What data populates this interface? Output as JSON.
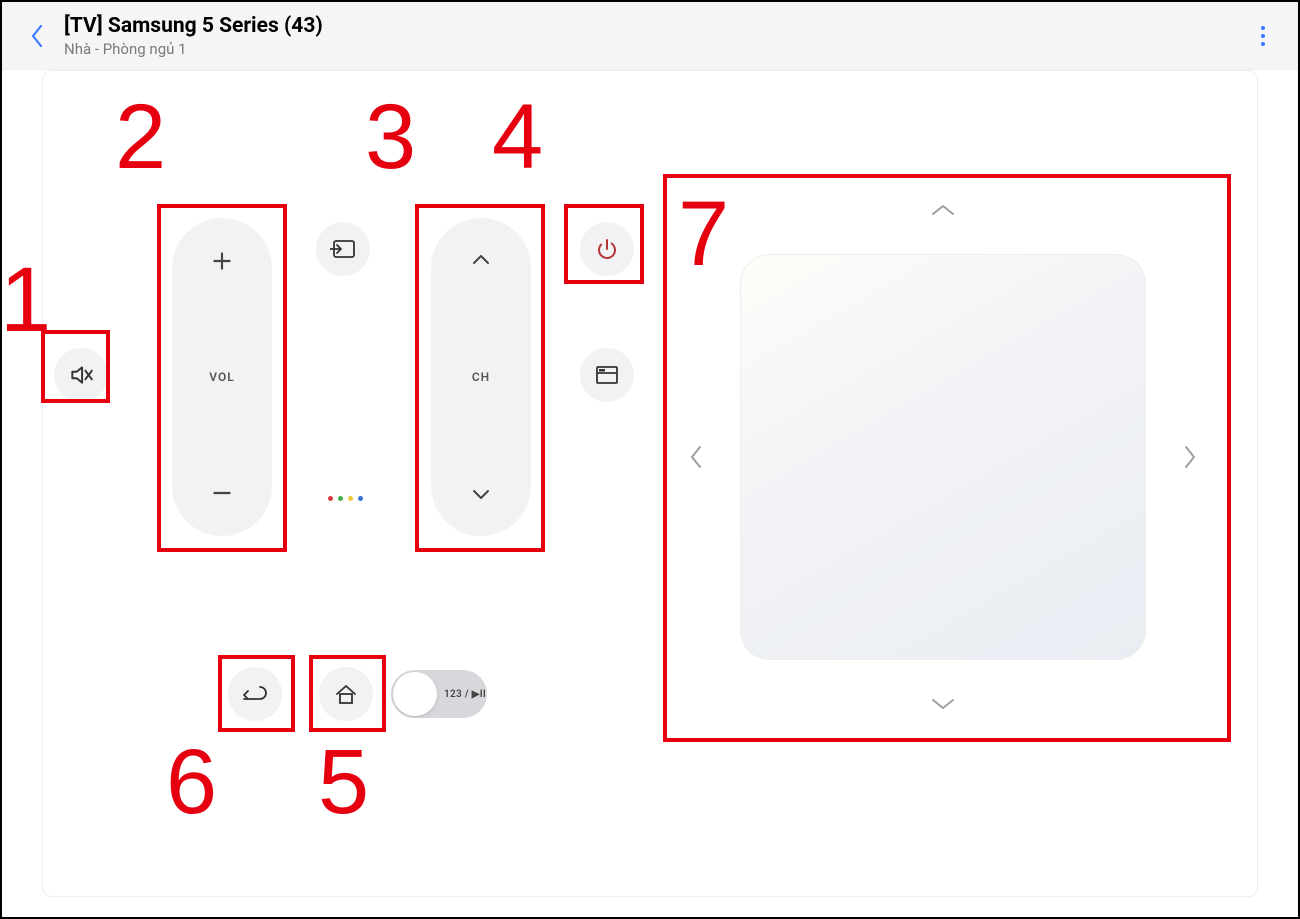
{
  "header": {
    "title": "[TV] Samsung 5 Series (43)",
    "location": "Nhà - Phòng ngủ 1"
  },
  "controls": {
    "vol_label": "VOL",
    "ch_label": "CH",
    "toggle_label": "123 / ▶II"
  },
  "annotations": {
    "n1": "1",
    "n2": "2",
    "n3": "3",
    "n4": "4",
    "n5": "5",
    "n6": "6",
    "n7": "7"
  }
}
